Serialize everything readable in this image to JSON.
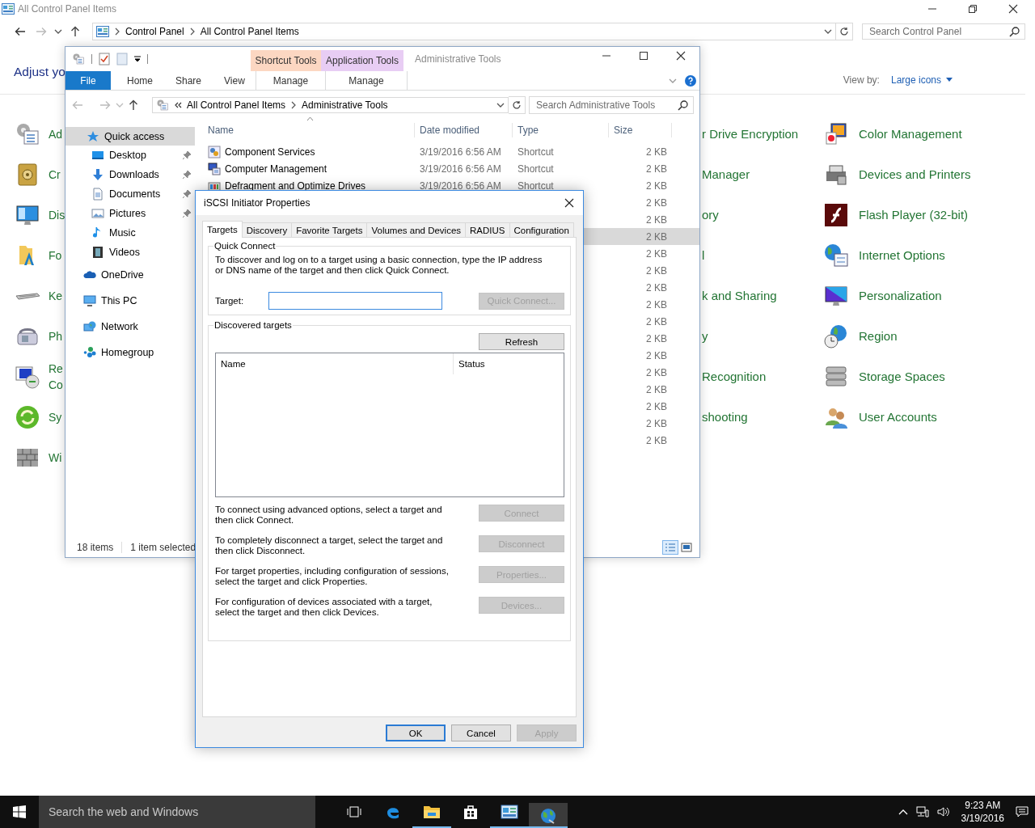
{
  "control_panel": {
    "title": "All Control Panel Items",
    "breadcrumb": [
      "Control Panel",
      "All Control Panel Items"
    ],
    "search": {
      "placeholder": "Search Control Panel"
    },
    "heading": "Adjust yo",
    "view_by": {
      "label": "View by:",
      "value": "Large icons"
    },
    "items_left": [
      "Ad",
      "Cr",
      "Dis",
      "Fo",
      "Ke",
      "Ph",
      "Re\nCo",
      "Sy",
      "Wi"
    ],
    "items_middle": [
      "r Drive Encryption",
      "Manager",
      "ory",
      "l",
      "k and Sharing",
      "y",
      "Recognition",
      "shooting"
    ],
    "items_right": [
      "Color Management",
      "Devices and Printers",
      "Flash Player (32-bit)",
      "Internet Options",
      "Personalization",
      "Region",
      "Storage Spaces",
      "User Accounts"
    ]
  },
  "explorer": {
    "title": "Administrative Tools",
    "contextual_tabs": [
      {
        "group": "Shortcut Tools",
        "tab": "Manage",
        "color": "#fcd7c2"
      },
      {
        "group": "Application Tools",
        "tab": "Manage",
        "color": "#e8cdf4"
      }
    ],
    "file_tab": "File",
    "ribbon_tabs": [
      "Home",
      "Share",
      "View"
    ],
    "address": [
      "All Control Panel Items",
      "Administrative Tools"
    ],
    "search": {
      "placeholder": "Search Administrative Tools"
    },
    "nav": [
      {
        "label": "Quick access",
        "selected": true,
        "children": [
          {
            "label": "Desktop",
            "pinned": true,
            "selected": false
          },
          {
            "label": "Downloads",
            "pinned": true,
            "selected": false
          },
          {
            "label": "Documents",
            "pinned": true,
            "selected": false
          },
          {
            "label": "Pictures",
            "pinned": true,
            "selected": false
          },
          {
            "label": "Music",
            "pinned": false,
            "selected": false
          },
          {
            "label": "Videos",
            "pinned": false,
            "selected": false
          }
        ]
      },
      {
        "label": "OneDrive",
        "selected": false
      },
      {
        "label": "This PC",
        "selected": false
      },
      {
        "label": "Network",
        "selected": false
      },
      {
        "label": "Homegroup",
        "selected": false
      }
    ],
    "columns": [
      "Name",
      "Date modified",
      "Type",
      "Size"
    ],
    "rows": [
      {
        "name": "Component Services",
        "date": "3/19/2016 6:56 AM",
        "type": "Shortcut",
        "size": "2 KB",
        "selected": false
      },
      {
        "name": "Computer Management",
        "date": "3/19/2016 6:56 AM",
        "type": "Shortcut",
        "size": "2 KB",
        "selected": false
      },
      {
        "name": "Defragment and Optimize Drives",
        "date": "3/19/2016 6:56 AM",
        "type": "Shortcut",
        "size": "2 KB",
        "selected": false
      },
      {
        "size": "2 KB",
        "selected": false
      },
      {
        "size": "2 KB",
        "selected": false
      },
      {
        "size": "2 KB",
        "selected": true
      },
      {
        "size": "2 KB",
        "selected": false
      },
      {
        "size": "2 KB",
        "selected": false
      },
      {
        "size": "2 KB",
        "selected": false
      },
      {
        "size": "2 KB",
        "selected": false
      },
      {
        "size": "2 KB",
        "selected": false
      },
      {
        "size": "2 KB",
        "selected": false
      },
      {
        "size": "2 KB",
        "selected": false
      },
      {
        "size": "2 KB",
        "selected": false
      },
      {
        "size": "2 KB",
        "selected": false
      },
      {
        "size": "2 KB",
        "selected": false
      },
      {
        "size": "2 KB",
        "selected": false
      },
      {
        "size": "2 KB",
        "selected": false
      }
    ],
    "status": {
      "count": "18 items",
      "selection": "1 item selected"
    }
  },
  "dialog": {
    "title": "iSCSI Initiator Properties",
    "tabs": [
      {
        "label": "Targets",
        "selected": true
      },
      {
        "label": "Discovery",
        "selected": false
      },
      {
        "label": "Favorite Targets",
        "selected": false
      },
      {
        "label": "Volumes and Devices",
        "selected": false
      },
      {
        "label": "RADIUS",
        "selected": false
      },
      {
        "label": "Configuration",
        "selected": false
      }
    ],
    "quick_connect": {
      "legend": "Quick Connect",
      "text": "To discover and log on to a target using a basic connection, type the IP address or DNS name of the target and then click Quick Connect.",
      "target_label": "Target:",
      "button": {
        "label": "Quick Connect...",
        "disabled": true
      }
    },
    "discovered": {
      "legend": "Discovered targets",
      "refresh": {
        "label": "Refresh",
        "disabled": false
      },
      "columns": [
        "Name",
        "Status"
      ],
      "actions": [
        {
          "text": "To connect using advanced options, select a target and then click Connect.",
          "button": {
            "label": "Connect",
            "disabled": true
          }
        },
        {
          "text": "To completely disconnect a target, select the target and then click Disconnect.",
          "button": {
            "label": "Disconnect",
            "disabled": true
          }
        },
        {
          "text": "For target properties, including configuration of sessions, select the target and click Properties.",
          "button": {
            "label": "Properties...",
            "disabled": true
          }
        },
        {
          "text": "For configuration of devices associated with a target, select the target and then click Devices.",
          "button": {
            "label": "Devices...",
            "disabled": true
          }
        }
      ]
    },
    "buttons": [
      {
        "label": "OK",
        "disabled": false,
        "default": true
      },
      {
        "label": "Cancel",
        "disabled": false,
        "default": false
      },
      {
        "label": "Apply",
        "disabled": true,
        "default": false
      }
    ]
  },
  "taskbar": {
    "search_placeholder": "Search the web and Windows",
    "apps": [
      {
        "kind": "taskview",
        "running": false,
        "active": false
      },
      {
        "kind": "edge",
        "running": false,
        "active": false
      },
      {
        "kind": "explorer",
        "running": true,
        "active": false
      },
      {
        "kind": "store",
        "running": false,
        "active": false
      },
      {
        "kind": "controlpanel",
        "running": true,
        "active": false
      },
      {
        "kind": "iscsi",
        "running": true,
        "active": true
      }
    ],
    "time": "9:23 AM",
    "date": "3/19/2016"
  }
}
